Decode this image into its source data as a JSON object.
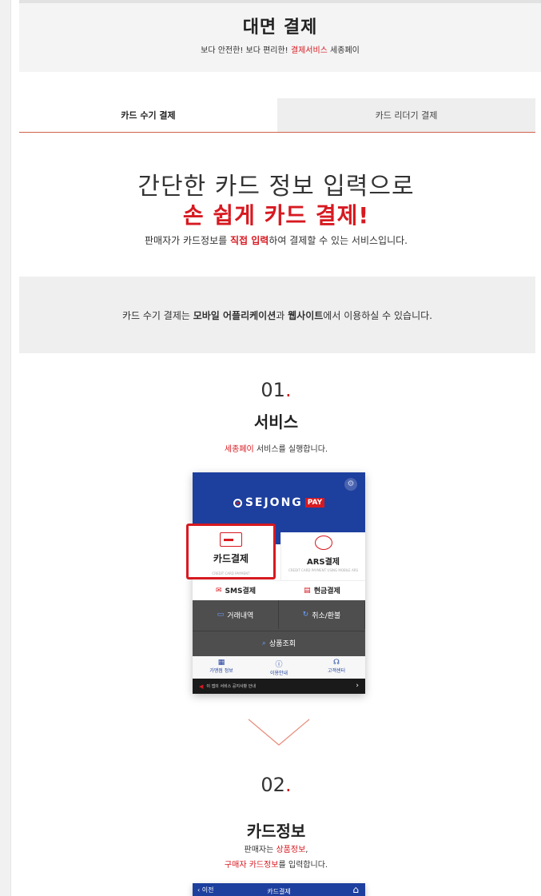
{
  "hero": {
    "title": "대면 결제",
    "sub_pre": "보다 안전한! 보다 편리한! ",
    "sub_highlight": "결제서비스",
    "sub_post": " 세종페이"
  },
  "tabs": [
    {
      "label": "카드 수기 결제",
      "active": true
    },
    {
      "label": "카드 리더기 결제",
      "active": false
    }
  ],
  "headline": {
    "line1": "간단한 카드 정보 입력으로",
    "line2": "손 쉽게 카드 결제!"
  },
  "desc": {
    "pre": "판매자가 카드정보를 ",
    "highlight": "직접 입력",
    "post": "하여 결제할 수 있는 서비스입니다."
  },
  "notice": {
    "pre": "카드 수기 결제는 ",
    "bold1": "모바일 어플리케이션",
    "mid": "과 ",
    "bold2": "웹사이트",
    "post": "에서 이용하실 수 있습니다."
  },
  "step1": {
    "num": "01",
    "dot": ".",
    "title": "서비스",
    "text_highlight": "세종페이",
    "text_post": " 서비스를 실행합니다."
  },
  "phone": {
    "logo": "SEJONG",
    "pay": "PAY",
    "card_label": "카드결제",
    "card_en": "CREDIT CARD PAYMENT",
    "ars_label": "ARS결제",
    "ars_en": "CREDIT CARD PAYMENT USING MOBILE ARS",
    "sms_label": "SMS결제",
    "cash_label": "현금결제",
    "history_label": "거래내역",
    "cancel_label": "취소/환불",
    "search_label": "상품조회",
    "bottom": [
      "가맹점 정보",
      "이용안내",
      "고객센터"
    ],
    "foot": "이 앱의 서비스 공지사항 안내"
  },
  "step2": {
    "num": "02",
    "dot": ".",
    "title": "카드정보",
    "line1_pre": "판매자는 ",
    "line1_highlight": "상품정보",
    "line1_post": ",",
    "line2_highlight": "구매자 카드정보",
    "line2_post": "를 입력합니다."
  },
  "phone2": {
    "back": "이전",
    "title": "카드결제"
  },
  "colors": {
    "brand_red": "#d71920",
    "brand_blue": "#1d3f9e"
  }
}
